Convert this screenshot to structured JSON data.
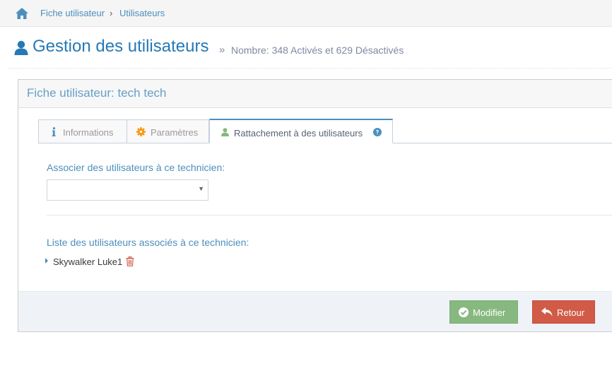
{
  "breadcrumb": {
    "home_icon": "home-icon",
    "items": [
      "Fiche utilisateur",
      "Utilisateurs"
    ],
    "separator": "›"
  },
  "header": {
    "icon": "user-icon",
    "title": "Gestion des utilisateurs",
    "arrow": "»",
    "subtitle": "Nombre: 348 Activés et 629 Désactivés"
  },
  "widget": {
    "title": "Fiche utilisateur: tech tech"
  },
  "tabs": [
    {
      "label": "Informations",
      "icon": "info-icon",
      "active": false
    },
    {
      "label": "Paramètres",
      "icon": "gear-icon",
      "active": false
    },
    {
      "label": "Rattachement à des utilisateurs",
      "icon": "user-icon",
      "active": true,
      "help_icon": "question-circle-icon"
    }
  ],
  "form": {
    "assoc_label": "Associer des utilisateurs à ce technicien:",
    "select_value": "",
    "list_label": "Liste des utilisateurs associés à ce technicien:",
    "users": [
      "Skywalker Luke1"
    ]
  },
  "footer": {
    "modifier_label": "Modifier",
    "retour_label": "Retour"
  },
  "colors": {
    "accent": "#4c8fbd",
    "title": "#2679b5",
    "success": "#87b87f",
    "danger": "#d15b47"
  }
}
